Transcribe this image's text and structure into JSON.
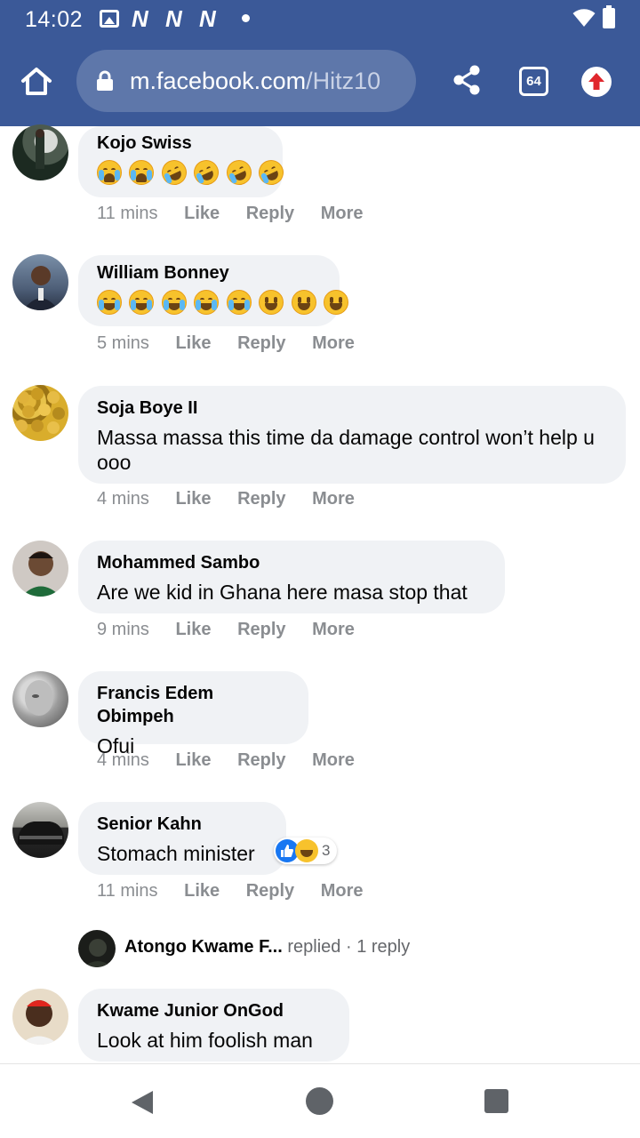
{
  "status_bar": {
    "time": "14:02",
    "notification_icons": [
      "image-icon",
      "nn-icon",
      "nn-icon",
      "nn-icon",
      "dot-icon"
    ],
    "right_icons": [
      "wifi-icon",
      "battery-icon"
    ]
  },
  "browser": {
    "url_domain": "m.facebook.com",
    "url_path": "/Hitz10",
    "tab_count": "64",
    "accent_color": "#3b5998"
  },
  "comments": [
    {
      "name": "Kojo Swiss",
      "text": "",
      "emojis": [
        "loudly-crying",
        "loudly-crying",
        "rofl",
        "rofl",
        "rofl",
        "rofl"
      ],
      "time": "11 mins"
    },
    {
      "name": "William Bonney",
      "text": "",
      "emojis": [
        "tears-of-joy",
        "tears-of-joy",
        "tears-of-joy",
        "tears-of-joy",
        "tears-of-joy",
        "grinning",
        "grinning",
        "grinning"
      ],
      "time": "5 mins"
    },
    {
      "name": "Soja Boye II",
      "text": "Massa massa this time da damage control won’t help u ooo",
      "time": "4 mins"
    },
    {
      "name": "Mohammed Sambo",
      "text": "Are we kid in Ghana here masa stop that",
      "time": "9 mins"
    },
    {
      "name": "Francis Edem Obimpeh",
      "text": "Ofui",
      "time": "4 mins"
    },
    {
      "name": "Senior Kahn",
      "text": "Stomach minister",
      "time": "11 mins",
      "reactions": {
        "types": [
          "like",
          "haha"
        ],
        "count": "3"
      }
    },
    {
      "name": "Kwame Junior OnGod",
      "text": "Look at him foolish man",
      "time": ""
    }
  ],
  "actions": {
    "like": "Like",
    "reply": "Reply",
    "more": "More"
  },
  "reply_preview": {
    "name": "Atongo Kwame F...",
    "verb": "replied",
    "separator": "·",
    "count": "1 reply"
  }
}
